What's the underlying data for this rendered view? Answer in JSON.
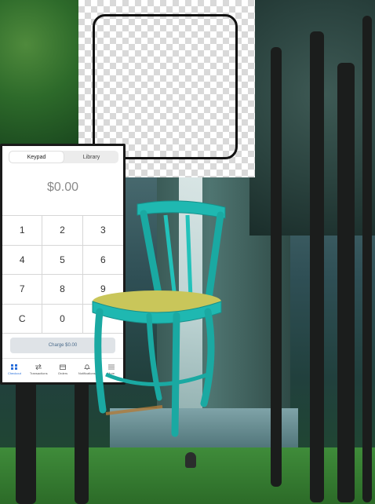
{
  "pos": {
    "tabs": [
      {
        "label": "Keypad",
        "active": true
      },
      {
        "label": "Library",
        "active": false
      }
    ],
    "amount": "$0.00",
    "keys": [
      "1",
      "2",
      "3",
      "4",
      "5",
      "6",
      "7",
      "8",
      "9",
      "C",
      "0",
      ""
    ],
    "charge_label": "Charge $0.00",
    "nav": [
      {
        "label": "Checkout",
        "icon": "grid-icon",
        "active": true
      },
      {
        "label": "Transactions",
        "icon": "arrows-icon",
        "active": false
      },
      {
        "label": "Orders",
        "icon": "box-icon",
        "active": false
      },
      {
        "label": "Notifications",
        "icon": "bell-icon",
        "active": false
      },
      {
        "label": "More",
        "icon": "menu-icon",
        "active": false
      }
    ]
  },
  "colors": {
    "accent": "#2a6fdb",
    "chair": "#1fb8b1"
  }
}
